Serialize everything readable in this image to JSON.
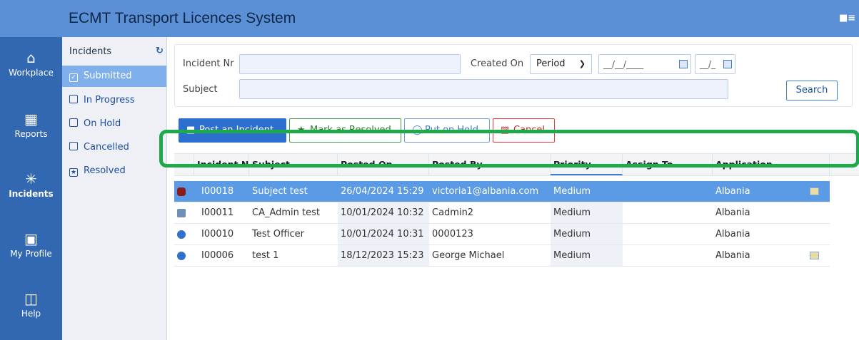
{
  "app": {
    "title": "ECMT Transport Licences System"
  },
  "leftnav": [
    {
      "label": "Workplace",
      "icon": "home-icon"
    },
    {
      "label": "Reports",
      "icon": "report-icon"
    },
    {
      "label": "Incidents",
      "icon": "bug-icon",
      "active": true
    },
    {
      "label": "My Profile",
      "icon": "profile-card-icon"
    },
    {
      "label": "Help",
      "icon": "help-icon"
    }
  ],
  "subnav": {
    "title": "Incidents",
    "items": [
      {
        "label": "Submitted",
        "active": true
      },
      {
        "label": "In Progress"
      },
      {
        "label": "On Hold"
      },
      {
        "label": "Cancelled"
      },
      {
        "label": "Resolved"
      }
    ]
  },
  "filters": {
    "incident_nr_label": "Incident Nr",
    "incident_nr_value": "",
    "subject_label": "Subject",
    "subject_value": "",
    "created_on_label": "Created On",
    "period_value": "Period",
    "date_from": "__/__/____",
    "date_to": "__/_",
    "search_label": "Search"
  },
  "actions": {
    "post": "Post an Incident",
    "resolve": "Mark as Resolved",
    "hold": "Put on Hold",
    "cancel": "Cancel"
  },
  "grid": {
    "columns": [
      "Incident No",
      "Subject",
      "Posted On",
      "Posted By",
      "Priority",
      "Assign To",
      "Application"
    ],
    "rows": [
      {
        "no": "I00018",
        "subject": "Subject test",
        "posted_on": "26/04/2024 15:29",
        "posted_by": "victoria1@albania.com",
        "priority": "Medium",
        "assign_to": "",
        "application": "Albania",
        "icon": "bug-icon",
        "selected": true
      },
      {
        "no": "I00011",
        "subject": "CA_Admin test",
        "posted_on": "10/01/2024 10:32",
        "posted_by": "Cadmin2",
        "priority": "Medium",
        "assign_to": "",
        "application": "Albania",
        "icon": "message-icon"
      },
      {
        "no": "I00010",
        "subject": "Test Officer",
        "posted_on": "10/01/2024 10:31",
        "posted_by": "0000123",
        "priority": "Medium",
        "assign_to": "",
        "application": "Albania",
        "icon": "info-icon"
      },
      {
        "no": "I00006",
        "subject": "test 1",
        "posted_on": "18/12/2023 15:23",
        "posted_by": "George Michael",
        "priority": "Medium",
        "assign_to": "",
        "application": "Albania",
        "icon": "info-icon"
      }
    ]
  },
  "colors": {
    "header": "#5b8fd6",
    "nav": "#3267b2",
    "selected_row": "#5b9be6",
    "highlight": "#1ea94b"
  }
}
